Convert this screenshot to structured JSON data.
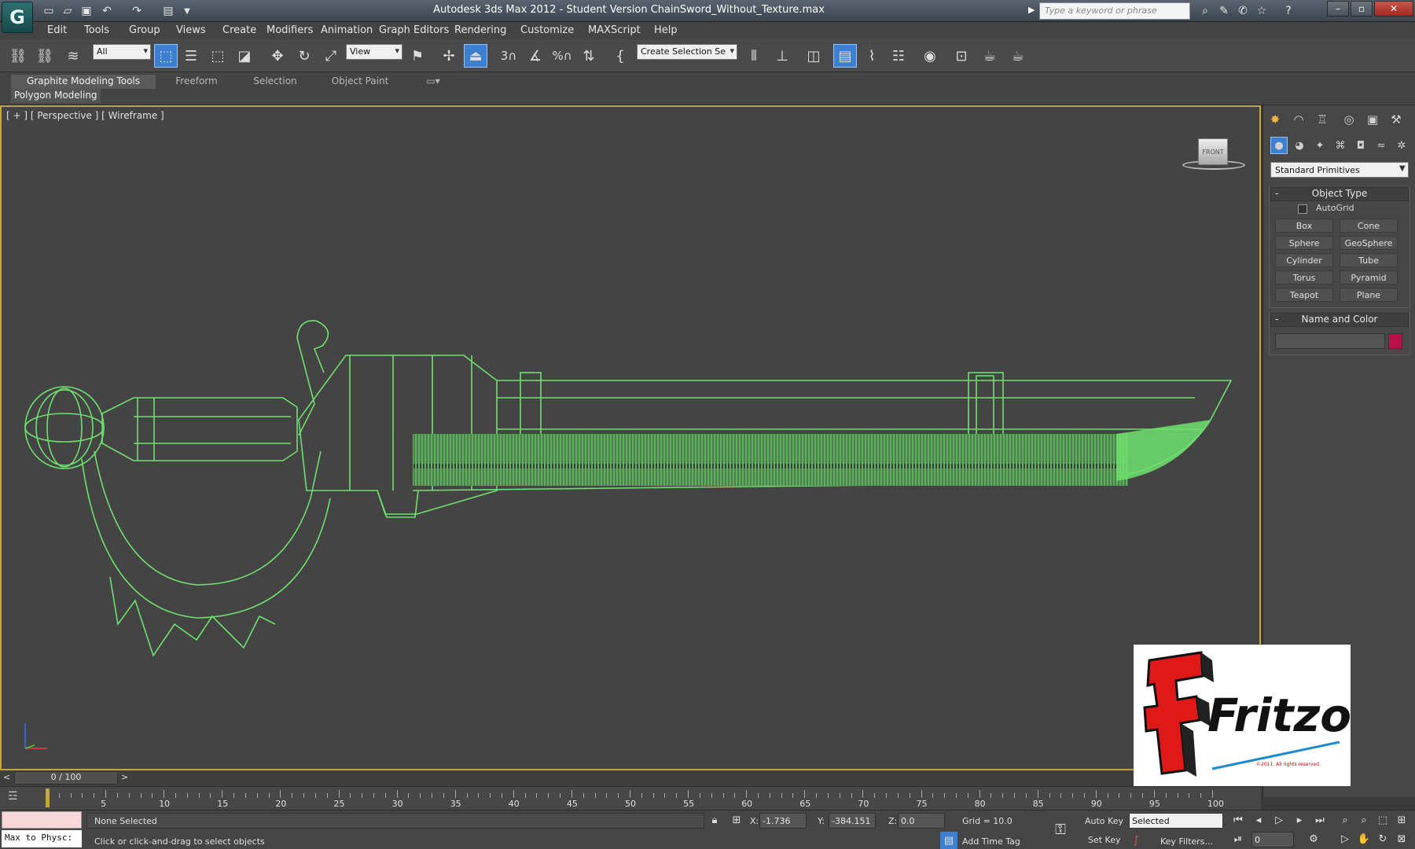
{
  "titlebar": {
    "title": "Autodesk 3ds Max  2012  - Student Version   ChainSword_Without_Texture.max",
    "search_placeholder": "Type a keyword or phrase"
  },
  "menu": [
    "Edit",
    "Tools",
    "Group",
    "Views",
    "Create",
    "Modifiers",
    "Animation",
    "Graph Editors",
    "Rendering",
    "Customize",
    "MAXScript",
    "Help"
  ],
  "toolbar": {
    "selection_filter": "All",
    "reference_coord": "View",
    "named_selection": "Create Selection Se",
    "spinner_snap": "3"
  },
  "ribbon": {
    "tabs": [
      "Graphite Modeling Tools",
      "Freeform",
      "Selection",
      "Object Paint"
    ],
    "panel": "Polygon Modeling"
  },
  "viewport": {
    "label": "[ + ] [ Perspective ] [ Wireframe ]",
    "viewcube_face": "FRONT",
    "wire_color": "#6fe06f"
  },
  "command_panel": {
    "category": "Standard Primitives",
    "object_type_title": "Object Type",
    "autogrid": "AutoGrid",
    "primitives": [
      "Box",
      "Cone",
      "Sphere",
      "GeoSphere",
      "Cylinder",
      "Tube",
      "Torus",
      "Pyramid",
      "Teapot",
      "Plane"
    ],
    "name_color_title": "Name and Color",
    "object_color": "#b8104a"
  },
  "timeline": {
    "frame": "0 / 100",
    "ticks": [
      "5",
      "10",
      "15",
      "20",
      "25",
      "30",
      "35",
      "40",
      "45",
      "50",
      "55",
      "60",
      "65",
      "70",
      "75",
      "80",
      "85",
      "90",
      "95",
      "100"
    ]
  },
  "status": {
    "maxscript": "Max to Physc:",
    "selection": "None Selected",
    "prompt": "Click or click-and-drag to select objects",
    "x_label": "X:",
    "x": "-1.736",
    "y_label": "Y:",
    "y": "-384.151",
    "z_label": "Z:",
    "z": "0.0",
    "grid": "Grid = 10.0",
    "add_time_tag": "Add Time Tag",
    "auto_key": "Auto Key",
    "set_key": "Set Key",
    "key_mode": "Selected",
    "key_filters": "Key Filters...",
    "current_frame": "0"
  },
  "watermark": {
    "brand": "Fritzo",
    "copyright": "©2011. All rights reserved."
  }
}
